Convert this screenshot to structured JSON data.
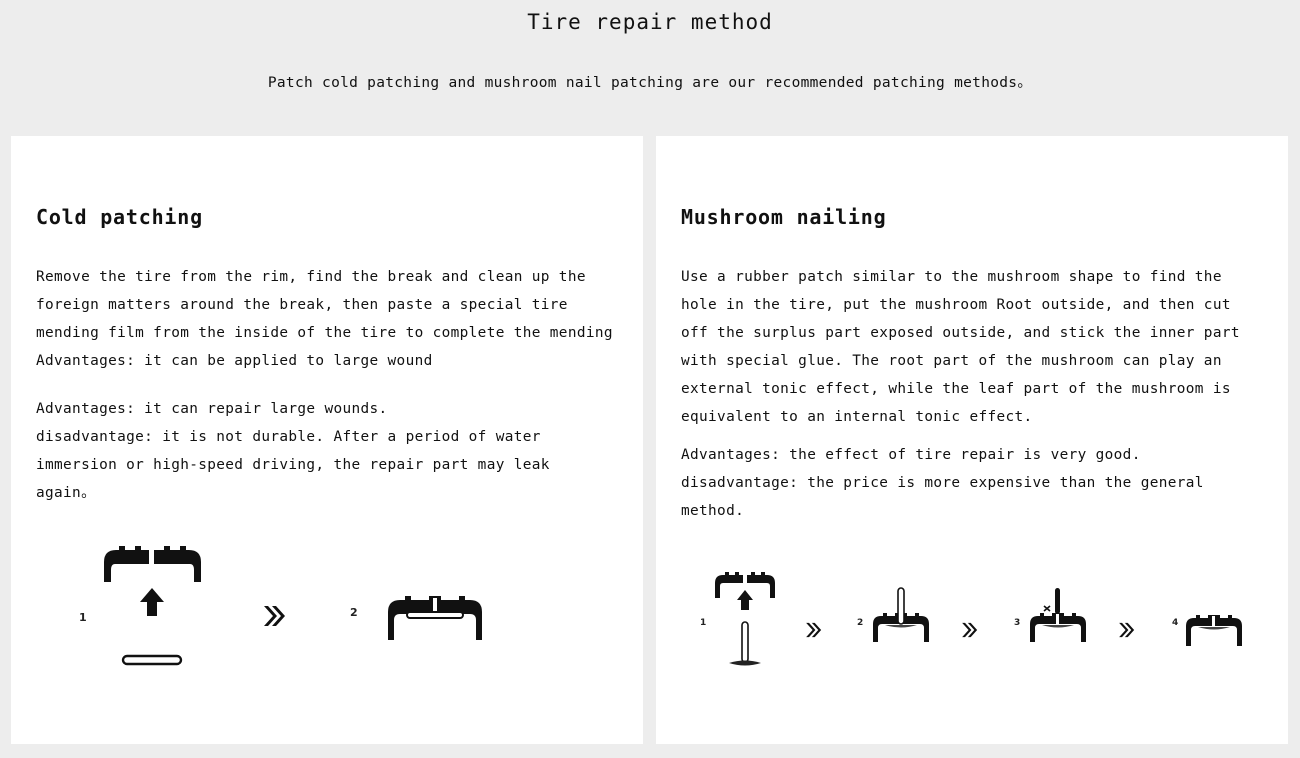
{
  "header": {
    "title": "Tire repair method",
    "subtitle": "Patch cold patching and mushroom nail patching are our recommended patching methods。"
  },
  "methods": [
    {
      "title": "Cold patching",
      "description": "Remove the tire from the rim, find the break and clean up the\nforeign matters around the break, then paste a special tire\nmending film from the inside of the tire to complete the mending\nAdvantages: it can be applied to large wound",
      "pros_cons": "Advantages: it can repair large wounds.\ndisadvantage: it is not durable. After a period of water\nimmersion or high-speed driving, the repair part may leak\nagain。",
      "steps": [
        {
          "number": "1",
          "icon": "tire-with-patch-insert-icon"
        },
        {
          "number": "2",
          "icon": "tire-patched-icon"
        }
      ]
    },
    {
      "title": "Mushroom nailing",
      "description": "Use a rubber patch similar to the mushroom shape to find the\nhole in the tire, put the mushroom Root outside, and then cut\noff the surplus part exposed outside, and stick the inner part\nwith special glue. The root part of the mushroom can play an\nexternal tonic effect, while the leaf part of the mushroom is\nequivalent to an internal tonic effect.",
      "pros_cons": "Advantages: the effect of tire repair is very good.\ndisadvantage: the price is more expensive than the general\nmethod.",
      "steps": [
        {
          "number": "1",
          "icon": "tire-with-mushroom-nail-insert-icon"
        },
        {
          "number": "2",
          "icon": "mushroom-nail-inserted-icon"
        },
        {
          "number": "3",
          "icon": "mushroom-nail-cut-icon"
        },
        {
          "number": "4",
          "icon": "mushroom-nail-finished-icon"
        }
      ]
    }
  ]
}
